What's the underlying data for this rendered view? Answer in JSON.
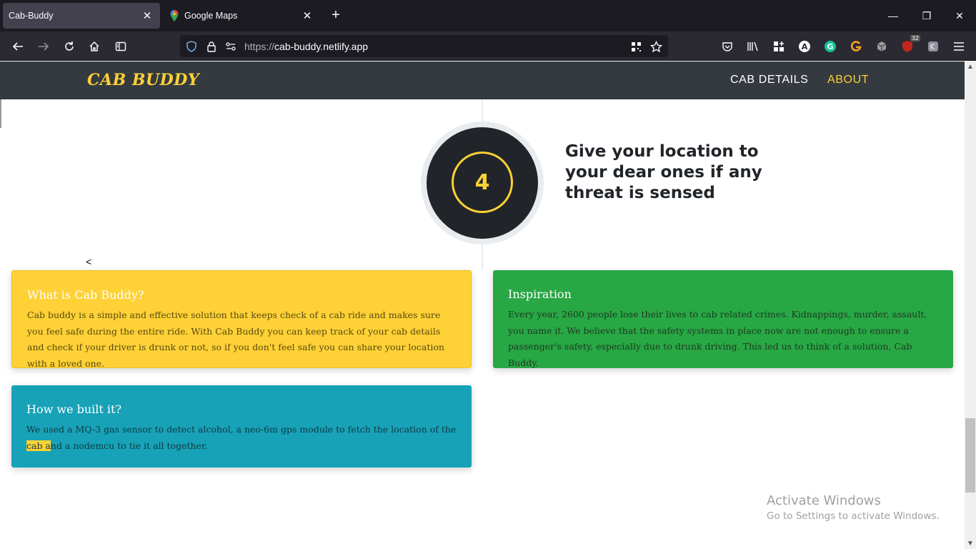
{
  "browser": {
    "tabs": [
      {
        "title": "Cab-Buddy",
        "active": true
      },
      {
        "title": "Google Maps",
        "active": false
      }
    ],
    "url_scheme": "https://",
    "url_host": "cab-buddy.netlify.app",
    "extension_badge": "32"
  },
  "site": {
    "brand": "CAB BUDDY",
    "nav": {
      "cab_details": "CAB DETAILS",
      "about": "ABOUT"
    },
    "timeline": {
      "step_number": "4",
      "heading": "Give your location to your dear ones if any threat is sensed"
    },
    "stray_char": "<",
    "cards": {
      "what": {
        "title": "What is Cab Buddy?",
        "body": "Cab buddy is a simple and effective solution that keeps check of a cab ride and makes sure you feel safe during the entire ride. With Cab Buddy you can keep track of your cab details and check if your driver is drunk or not, so if you don't feel safe you can share your location with a loved one."
      },
      "inspiration": {
        "title": "Inspiration",
        "body": "Every year, 2600 people lose their lives to cab related crimes. Kidnappings, murder, assault, you name it. We believe that the safety systems in place now are not enough to ensure a passenger's safety, especially due to drunk driving. This led us to think of a solution, Cab Buddy."
      },
      "built": {
        "title": "How we built it?",
        "body_before": "We used a MQ-3 gas sensor to detect alcohol, a neo-6m gps module to fetch the location of the ",
        "body_highlight": "cab a",
        "body_after": "nd a nodemcu to tie it all together."
      }
    }
  },
  "watermark": {
    "line1": "Activate Windows",
    "line2": "Go to Settings to activate Windows."
  },
  "colors": {
    "brand_yellow": "#fed136",
    "nav_bg": "#343a40",
    "card_green": "#28a745",
    "card_teal": "#17a2b8"
  }
}
